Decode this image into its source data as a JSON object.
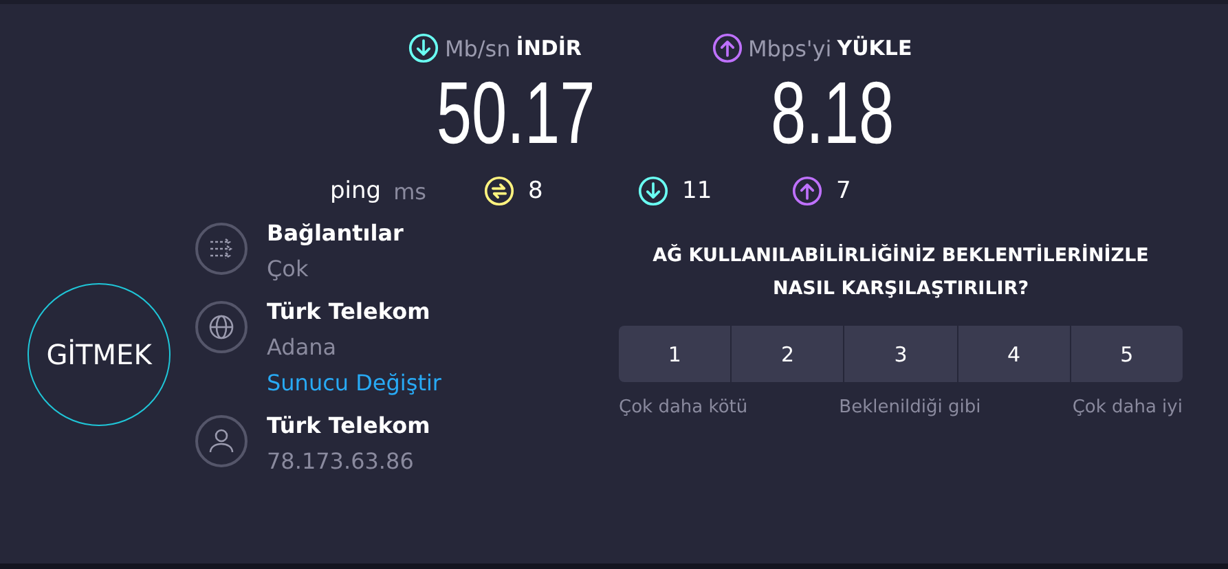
{
  "speeds": [
    {
      "kind": "download",
      "unit": "Mb/sn",
      "label": "İNDİR",
      "value": "50.17"
    },
    {
      "kind": "upload",
      "unit": "Mbps'yi",
      "label": "YÜKLE",
      "value": "8.18"
    }
  ],
  "ping": {
    "label": "ping",
    "unit": "ms",
    "items": [
      {
        "kind": "ping",
        "value": "8"
      },
      {
        "kind": "download",
        "value": "11"
      },
      {
        "kind": "upload",
        "value": "7"
      }
    ]
  },
  "go_button": "GİTMEK",
  "info": [
    {
      "kind": "connections",
      "title": "Bağlantılar",
      "value": "Çok"
    },
    {
      "kind": "server",
      "title": "Türk Telekom",
      "value": "Adana",
      "link": "Sunucu Değiştir"
    },
    {
      "kind": "user",
      "title": "Türk Telekom",
      "value": "78.173.63.86"
    }
  ],
  "survey": {
    "question": "AĞ KULLANILABİLİRLİĞİNİZ BEKLENTİLERİNİZLE NASIL KARŞILAŞTIRILIR?",
    "options": [
      "1",
      "2",
      "3",
      "4",
      "5"
    ],
    "scale_labels": [
      "Çok daha kötü",
      "Beklenildiği gibi",
      "Çok daha iyi"
    ]
  }
}
